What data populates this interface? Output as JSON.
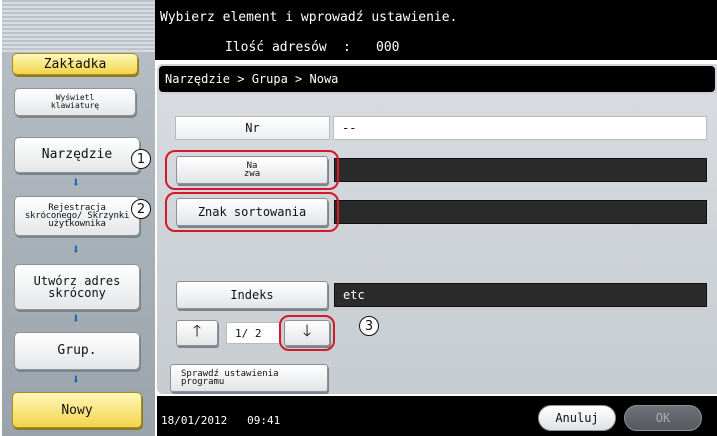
{
  "topbar": {
    "message": "Wybierz element i wprowadź ustawienie.",
    "address_label": "Ilość adresów",
    "address_sep": ":",
    "address_count": "000"
  },
  "sidebar": {
    "bookmark_tab": "Zakładka",
    "keyboard_btn": "Wyświetl klawiaturę",
    "steps": [
      {
        "label": "Narzędzie"
      },
      {
        "label": "Rejestracja skróconego/ Skrzynki użytkownika"
      },
      {
        "label": "Utwórz adres skrócony"
      },
      {
        "label": "Grup."
      },
      {
        "label": "Nowy"
      }
    ],
    "arrow_glyph": "⬇"
  },
  "breadcrumb": "Narzędzie > Grupa > Nowa",
  "form": {
    "nr_label": "Nr",
    "nr_value": "--",
    "name_btn": "Na zwa",
    "name_value": "",
    "sort_btn": "Znak sortowania",
    "sort_value": "",
    "index_btn": "Indeks",
    "index_value": "etc"
  },
  "pager": {
    "up_glyph": "🡑",
    "page_text": "1/ 2",
    "down_glyph": "🡓"
  },
  "check_program_btn": "Sprawdź ustawienia programu",
  "callouts": [
    "1",
    "2",
    "3"
  ],
  "footer": {
    "datetime": "18/01/2012   09:41",
    "cancel": "Anuluj",
    "ok": "OK"
  },
  "colors": {
    "callout_red": "#d4182a",
    "selected_tab": "#f2d44c",
    "arrow_blue": "#1565c0"
  }
}
